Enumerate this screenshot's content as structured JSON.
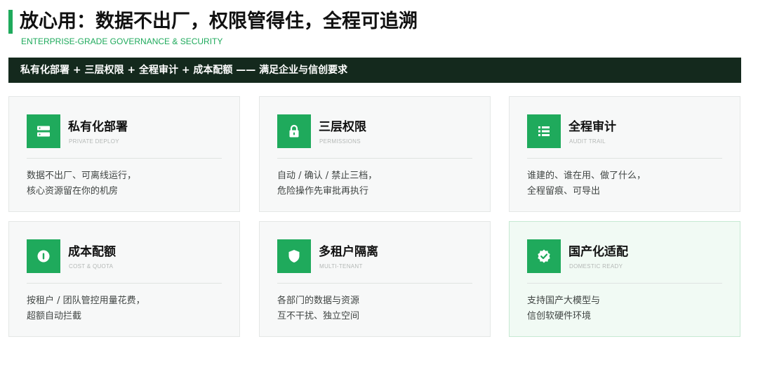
{
  "header": {
    "title": "放心用：数据不出厂，权限管得住，全程可追溯",
    "subtitle": "ENTERPRISE-GRADE GOVERNANCE & SECURITY"
  },
  "banner": {
    "text": "私有化部署 + 三层权限 + 全程审计 + 成本配额 —— 满足企业与信创要求"
  },
  "colors": {
    "accent": "#1faa5c",
    "banner_bg": "#14291d",
    "card_bg": "#f7f8f8",
    "card_highlight_bg": "#f1faf4"
  },
  "cards": [
    {
      "icon": "server-icon",
      "title": "私有化部署",
      "subtitle": "PRIVATE DEPLOY",
      "lines": [
        "数据不出厂、可离线运行，",
        "核心资源留在你的机房"
      ]
    },
    {
      "icon": "lock-icon",
      "title": "三层权限",
      "subtitle": "PERMISSIONS",
      "lines": [
        "自动 / 确认 / 禁止三档，",
        "危险操作先审批再执行"
      ]
    },
    {
      "icon": "list-icon",
      "title": "全程审计",
      "subtitle": "AUDIT TRAIL",
      "lines": [
        "谁建的、谁在用、做了什么，",
        "全程留痕、可导出"
      ]
    },
    {
      "icon": "quota-icon",
      "title": "成本配额",
      "subtitle": "COST & QUOTA",
      "lines": [
        "按租户 / 团队管控用量花费，",
        "超额自动拦截"
      ]
    },
    {
      "icon": "shield-icon",
      "title": "多租户隔离",
      "subtitle": "MULTI-TENANT",
      "lines": [
        "各部门的数据与资源",
        "互不干扰、独立空间"
      ]
    },
    {
      "icon": "check-badge-icon",
      "title": "国产化适配",
      "subtitle": "DOMESTIC READY",
      "lines": [
        "支持国产大模型与",
        "信创软硬件环境"
      ]
    }
  ]
}
